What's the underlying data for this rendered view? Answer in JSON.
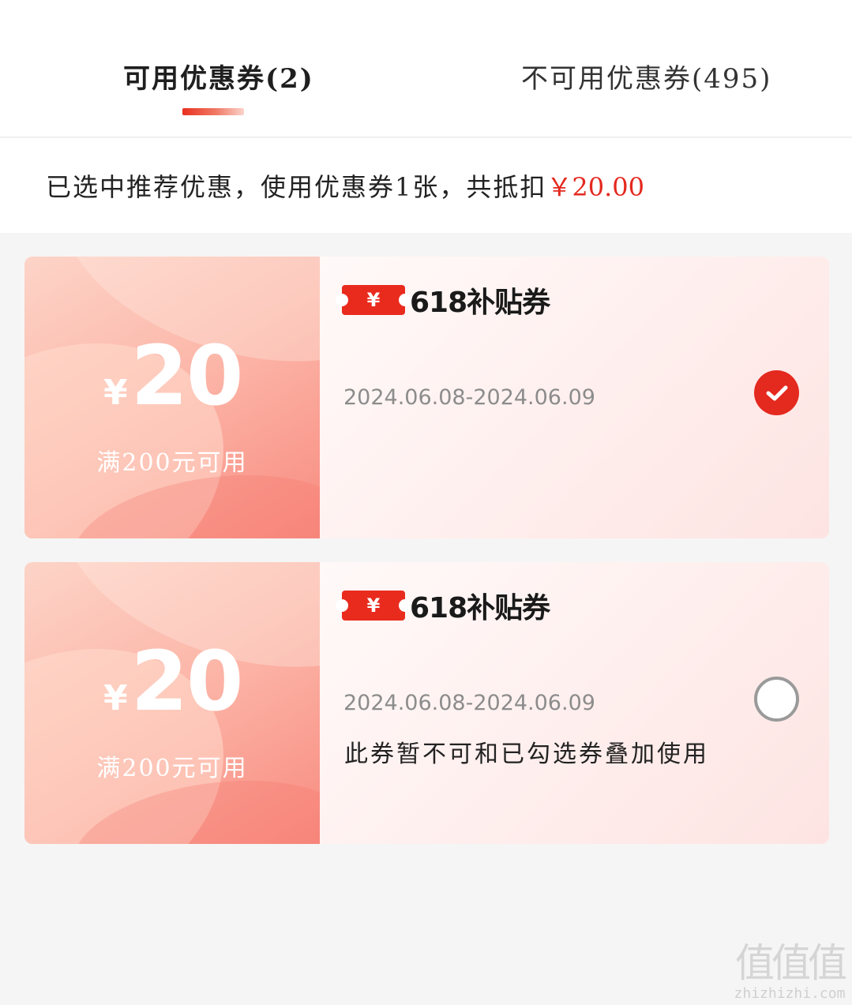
{
  "tabs": {
    "available": "可用优惠券(2)",
    "unavailable": "不可用优惠券(495)"
  },
  "summary": {
    "text": "已选中推荐优惠，使用优惠券1张，共抵扣",
    "amount": "￥20.00"
  },
  "coupons": [
    {
      "currency": "¥",
      "value": "20",
      "threshold": "满200元可用",
      "badge_symbol": "¥",
      "badge_text": "618补贴券",
      "dates": "2024.06.08-2024.06.09",
      "note": "",
      "selected": true
    },
    {
      "currency": "¥",
      "value": "20",
      "threshold": "满200元可用",
      "badge_symbol": "¥",
      "badge_text": "618补贴券",
      "dates": "2024.06.08-2024.06.09",
      "note": "此券暂不可和已勾选券叠加使用",
      "selected": false
    }
  ],
  "watermark": {
    "glyphs": "值值值",
    "url": "zhizhizhi.com"
  },
  "colors": {
    "accent": "#e4291f",
    "coupon_left": "#f88b80"
  }
}
